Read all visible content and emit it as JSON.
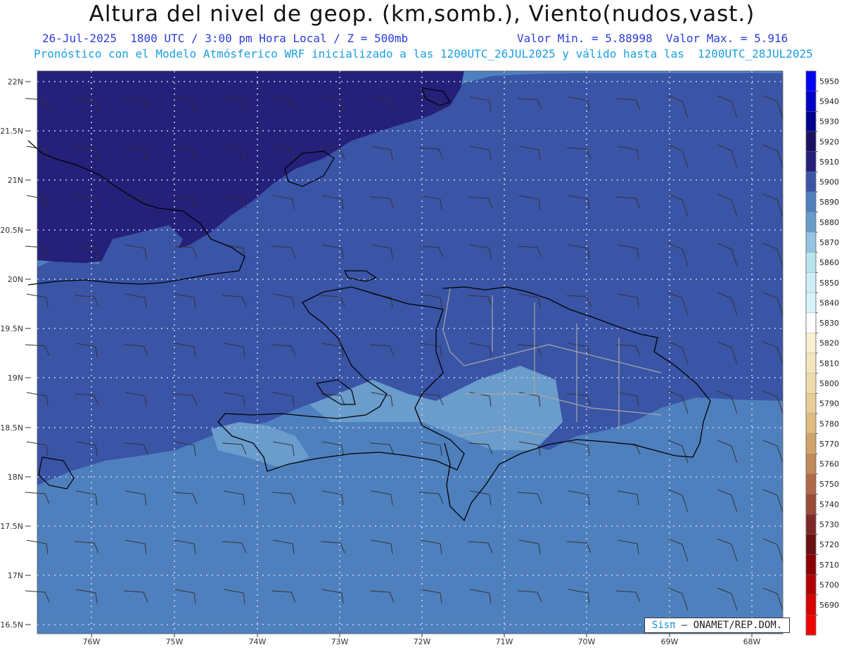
{
  "header": {
    "title": "Altura del nivel de geop. (km,somb.), Viento(nudos,vast.)",
    "datetime": "26-Jul-2025  1800 UTC / 3:00 pm Hora Local / Z = 500mb",
    "minmax": "Valor Min. = 5.88998  Valor Max. = 5.916",
    "model_line": "Pronóstico con el Modelo Atmósferico WRF inicializado a las 1200UTC_26JUL2025 y válido hasta las  1200UTC_28JUL2025"
  },
  "map": {
    "lat_labels": [
      "22N",
      "21.5N",
      "21N",
      "20.5N",
      "20N",
      "19.5N",
      "19N",
      "18.5N",
      "18N",
      "17.5N",
      "17N",
      "16.5N"
    ],
    "lon_labels": [
      "76W",
      "75W",
      "74W",
      "73W",
      "72W",
      "71W",
      "70W",
      "69W",
      "68W"
    ],
    "colors": {
      "z5920": "#25207a",
      "z5910": "#3a54a6",
      "z5900": "#4f80be",
      "z5890": "#6a9ccc",
      "coast": "#000000",
      "border": "#a8a8a8"
    }
  },
  "colorbar": {
    "levels": [
      "5950",
      "5940",
      "5930",
      "5920",
      "5910",
      "5900",
      "5890",
      "5880",
      "5870",
      "5860",
      "5850",
      "5840",
      "5830",
      "5820",
      "5810",
      "5800",
      "5790",
      "5780",
      "5770",
      "5760",
      "5750",
      "5740",
      "5730",
      "5720",
      "5710",
      "5700",
      "5690"
    ],
    "colors": [
      "#0000ff",
      "#0000c8",
      "#000090",
      "#1a1460",
      "#25207a",
      "#3a54a6",
      "#4f80be",
      "#6a9ccc",
      "#94c4e2",
      "#b8e4f0",
      "#cceef6",
      "#d8f4fa",
      "#ffffff",
      "#f8f0d0",
      "#f4e6bc",
      "#eedcaa",
      "#e8cd96",
      "#e0bb80",
      "#d0a36c",
      "#c2895a",
      "#b06a48",
      "#9a4a38",
      "#7e2828",
      "#6a1010",
      "#8a0000",
      "#b00000",
      "#d80000",
      "#f00000"
    ]
  },
  "credit": {
    "brand": "Sisπ",
    "text": "– ONAMET/REP.DOM."
  }
}
